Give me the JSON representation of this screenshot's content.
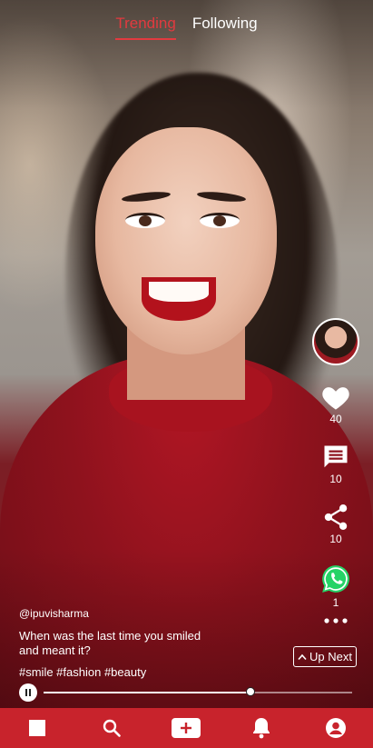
{
  "top_tabs": {
    "trending": "Trending",
    "following": "Following",
    "active": "trending"
  },
  "actions": {
    "like_count": "40",
    "comment_count": "10",
    "share_count": "10",
    "whatsapp_count": "1"
  },
  "caption": {
    "username": "@ipuvisharma",
    "text": "When was the last time you smiled and meant it?",
    "hashtags": "#smile #fashion #beauty"
  },
  "up_next_label": "Up Next",
  "playback": {
    "progress_fraction": 0.67,
    "state": "playing"
  },
  "nav": {
    "items": [
      "home-icon",
      "search-icon",
      "add-icon",
      "bell-icon",
      "profile-icon"
    ]
  },
  "colors": {
    "accent": "#e23a3f",
    "nav_bg": "#c8232c",
    "whatsapp": "#25d366"
  }
}
